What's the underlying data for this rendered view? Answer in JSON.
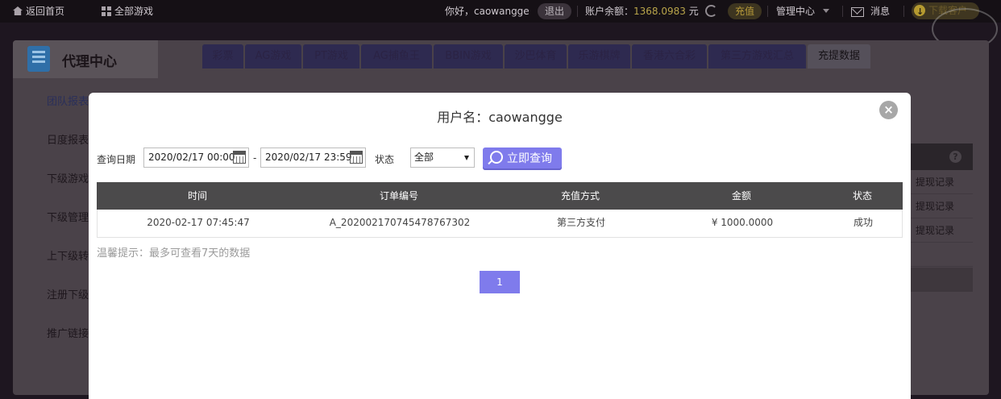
{
  "topbar": {
    "home": "返回首页",
    "all_games": "全部游戏",
    "greeting": "你好，caowangge",
    "logout": "退出",
    "balance_label": "账户余额：",
    "balance_value": "1368.0983",
    "balance_unit": "元",
    "recharge": "充值",
    "manage": "管理中心",
    "messages": "消息",
    "download": "下载客户"
  },
  "background": {
    "title": "代理中心",
    "sidebar": [
      "团队报表",
      "日度报表",
      "下级游戏",
      "下级管理",
      "上下级转",
      "注册下级",
      "推广链接"
    ],
    "tabs": [
      "彩票",
      "AG游戏",
      "PT游戏",
      "AG捕鱼王",
      "BBIN游戏",
      "沙巴体育",
      "乐游棋牌",
      "香港六合彩",
      "第三方游戏汇总",
      "充提数据"
    ],
    "active_tab": 9,
    "right_rows": [
      "提现记录",
      "提现记录",
      "提现记录"
    ],
    "help": "?"
  },
  "modal": {
    "title": "用户名：caowangge",
    "close": "×",
    "query_date_label": "查询日期",
    "start_date": "2020/02/17 00:00",
    "date_sep": "-",
    "end_date": "2020/02/17 23:59",
    "status_label": "状态",
    "status_value": "全部",
    "query_button": "立即查询",
    "table": {
      "headers": [
        "时间",
        "订单编号",
        "充值方式",
        "金额",
        "状态"
      ],
      "rows": [
        [
          "2020-02-17 07:45:47",
          "A_202002170745478767302",
          "第三方支付",
          "¥ 1000.0000",
          "成功"
        ]
      ]
    },
    "tip": "温馨提示：最多可查看7天的数据",
    "page": "1"
  },
  "colors": {
    "accent": "#7f7bec",
    "table_header": "#4b4a4b",
    "balance": "#b8a44a"
  }
}
